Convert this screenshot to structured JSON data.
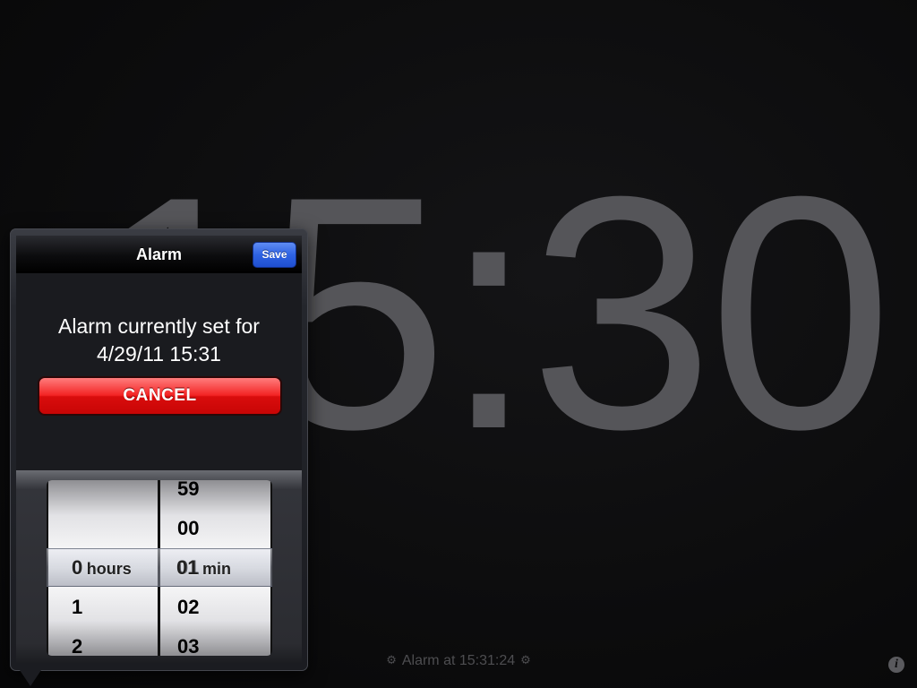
{
  "clock": {
    "time": "15:30"
  },
  "status": {
    "alarm_label": "Alarm at 15:31:24",
    "icon_left": "gear-icon",
    "icon_right": "gear-icon"
  },
  "info_button": {
    "icon": "info-icon",
    "label": "i"
  },
  "popover": {
    "title": "Alarm",
    "save_label": "Save",
    "alarm_line1": "Alarm currently set for",
    "alarm_line2": "4/29/11 15:31",
    "cancel_label": "CANCEL",
    "picker": {
      "hours": {
        "rows": [
          "",
          "",
          "0",
          "1",
          "2"
        ],
        "selected": "0",
        "unit": "hours"
      },
      "minutes": {
        "rows": [
          "59",
          "00",
          "01",
          "02",
          "03"
        ],
        "selected": "01",
        "unit": "min"
      }
    }
  },
  "colors": {
    "save_button": "#2e63e3",
    "cancel_button": "#f32424",
    "clock_text": "#555559"
  }
}
